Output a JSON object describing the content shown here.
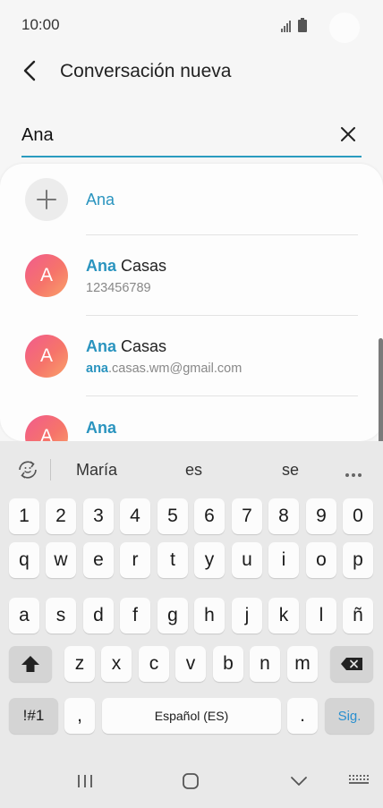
{
  "status_bar": {
    "time": "10:00"
  },
  "header": {
    "title": "Conversación nueva"
  },
  "recipient": {
    "value": "Ana"
  },
  "suggestions": {
    "add": {
      "label": "Ana"
    },
    "items": [
      {
        "initial": "A",
        "name_match": "Ana",
        "name_rest": " Casas",
        "sub_match": "",
        "sub_rest": "123456789"
      },
      {
        "initial": "A",
        "name_match": "Ana",
        "name_rest": " Casas",
        "sub_match": "ana",
        "sub_rest": ".casas.wm@gmail.com"
      },
      {
        "initial": "A",
        "name_match": "Ana",
        "name_rest": ""
      }
    ]
  },
  "keyboard": {
    "suggestions": [
      "María",
      "es",
      "se"
    ],
    "row_numbers": [
      "1",
      "2",
      "3",
      "4",
      "5",
      "6",
      "7",
      "8",
      "9",
      "0"
    ],
    "row_q": [
      "q",
      "w",
      "e",
      "r",
      "t",
      "y",
      "u",
      "i",
      "o",
      "p"
    ],
    "row_a": [
      "a",
      "s",
      "d",
      "f",
      "g",
      "h",
      "j",
      "k",
      "l",
      "ñ"
    ],
    "row_z": [
      "z",
      "x",
      "c",
      "v",
      "b",
      "n",
      "m"
    ],
    "symbols_label": "!#1",
    "comma_label": ",",
    "space_label": "Español (ES)",
    "period_label": ".",
    "next_label": "Sig."
  },
  "colors": {
    "accent": "#2a9bbf",
    "highlight": "#2a94bf",
    "keyboard_bg": "#e9e9e9"
  }
}
